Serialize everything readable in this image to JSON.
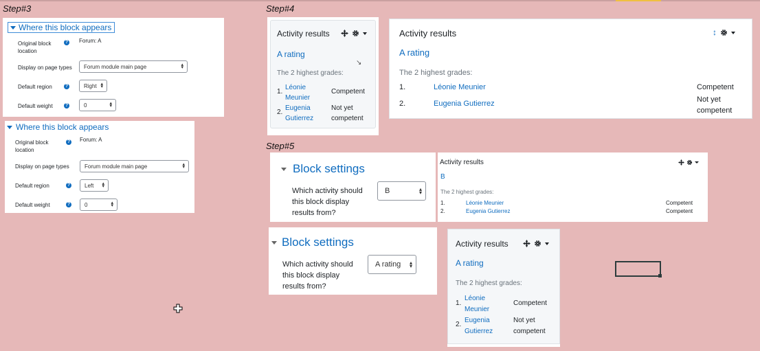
{
  "steps": {
    "step3": "Step#3",
    "step4": "Step#4",
    "step5": "Step#5"
  },
  "where_panel_1": {
    "title": "Where this block appears",
    "original_label_1": "Original block",
    "original_label_2": "location",
    "original_value": "Forum: A",
    "display_label": "Display on page types",
    "display_value": "Forum module main page",
    "region_label": "Default region",
    "region_value": "Right",
    "weight_label": "Default weight",
    "weight_value": "0"
  },
  "where_panel_2": {
    "title": "Where this block appears",
    "original_label_1": "Original block",
    "original_label_2": "location",
    "original_value": "Forum: A",
    "display_label": "Display on page types",
    "display_value": "Forum module main page",
    "region_label": "Default region",
    "region_value": "Left",
    "weight_label": "Default weight",
    "weight_value": "0"
  },
  "activity_small": {
    "title": "Activity results",
    "link": "A rating",
    "subtitle": "The 2 highest grades:",
    "rows": [
      {
        "num": "1.",
        "name1": "Léonie",
        "name2": "Meunier",
        "grade1": "Competent",
        "grade2": ""
      },
      {
        "num": "2.",
        "name1": "Eugenia",
        "name2": "Gutierrez",
        "grade1": "Not yet",
        "grade2": "competent"
      }
    ]
  },
  "activity_wide": {
    "title": "Activity results",
    "link": "A rating",
    "subtitle": "The 2 highest grades:",
    "rows": [
      {
        "num": "1.",
        "name": "Léonie Meunier",
        "grade1": "Competent",
        "grade2": ""
      },
      {
        "num": "2.",
        "name": "Eugenia Gutierrez",
        "grade1": "Not yet",
        "grade2": "competent"
      }
    ]
  },
  "settings_1": {
    "title": "Block settings",
    "question_1": "Which activity should",
    "question_2": "this block display",
    "question_3": "results from?",
    "select_value": "B"
  },
  "activity_b": {
    "title": "Activity results",
    "link": "B",
    "subtitle": "The 2 highest grades:",
    "rows": [
      {
        "num": "1.",
        "name": "Léonie Meunier",
        "grade": "Competent"
      },
      {
        "num": "2.",
        "name": "Eugenia Gutierrez",
        "grade": "Competent"
      }
    ]
  },
  "settings_2": {
    "title": "Block settings",
    "question_1": "Which activity should",
    "question_2": "this block display",
    "question_3": "results from?",
    "select_value": "A rating"
  },
  "activity_bottom": {
    "title": "Activity results",
    "link": "A rating",
    "subtitle": "The 2 highest grades:",
    "rows": [
      {
        "num": "1.",
        "name1": "Léonie",
        "name2": "Meunier",
        "grade1": "Competent",
        "grade2": ""
      },
      {
        "num": "2.",
        "name1": "Eugenia",
        "name2": "Gutierrez",
        "grade1": "Not yet",
        "grade2": "competent"
      }
    ]
  }
}
